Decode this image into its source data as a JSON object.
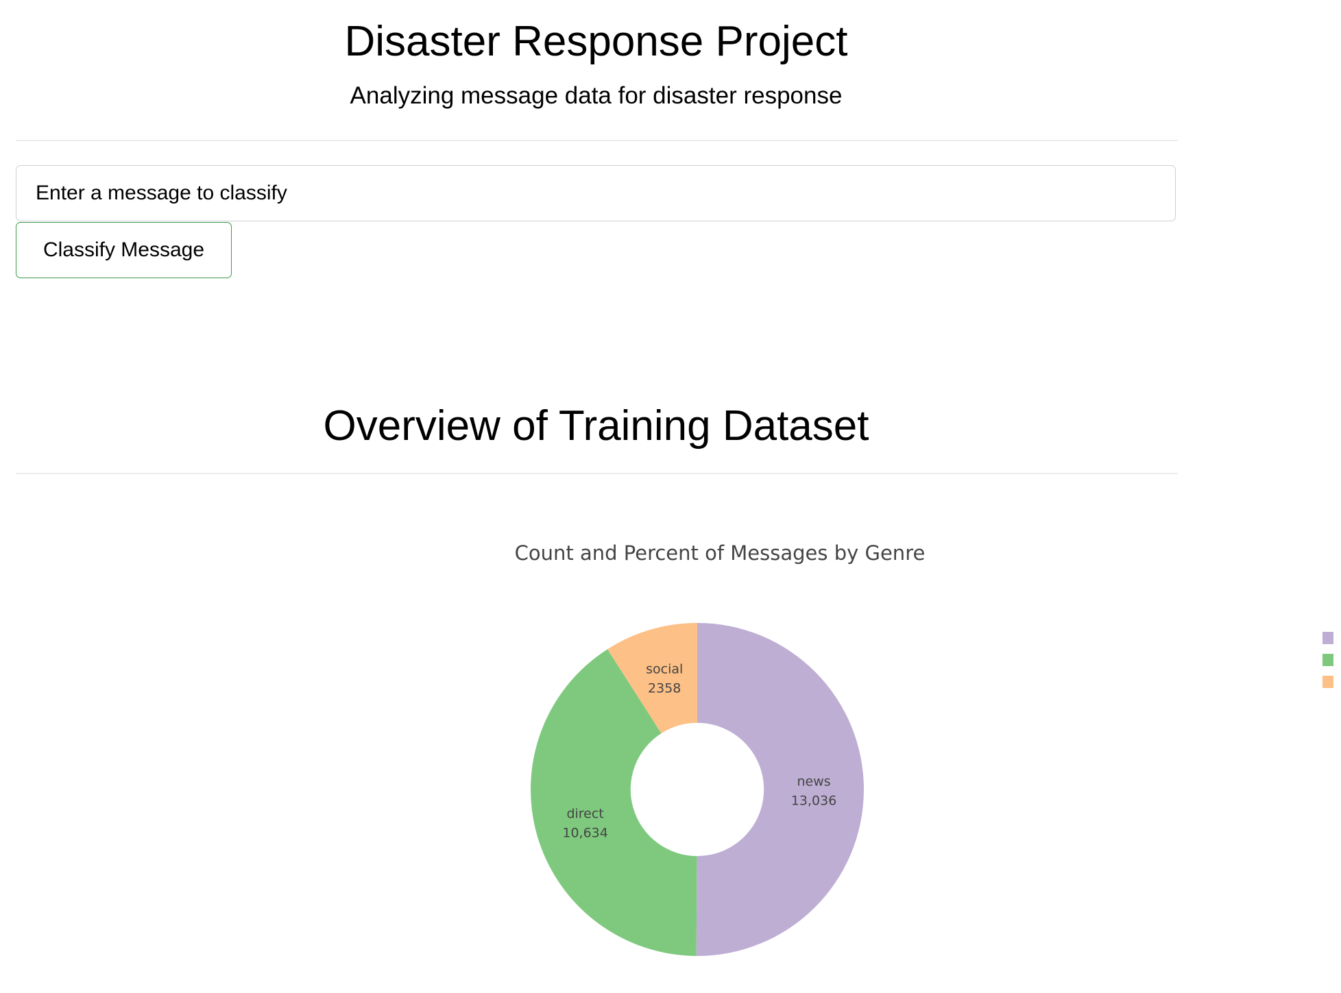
{
  "header": {
    "title": "Disaster Response Project",
    "subtitle": "Analyzing message data for disaster response"
  },
  "classifier": {
    "input_placeholder": "Enter a message to classify",
    "button_label": "Classify Message",
    "button_border_color": "#3c9a48"
  },
  "overview": {
    "title": "Overview of Training Dataset"
  },
  "chart_data": {
    "type": "pie",
    "title": "Count and Percent of Messages by Genre",
    "hole": 0.4,
    "labels": [
      "news",
      "direct",
      "social"
    ],
    "values": [
      13036,
      10634,
      2358
    ],
    "display_values": [
      "13,036",
      "10,634",
      "2358"
    ],
    "colors": [
      "#beaed4",
      "#7fc97f",
      "#fdc086"
    ],
    "legend": {
      "position": "right",
      "entries": [
        "news",
        "direct",
        "social"
      ]
    }
  }
}
